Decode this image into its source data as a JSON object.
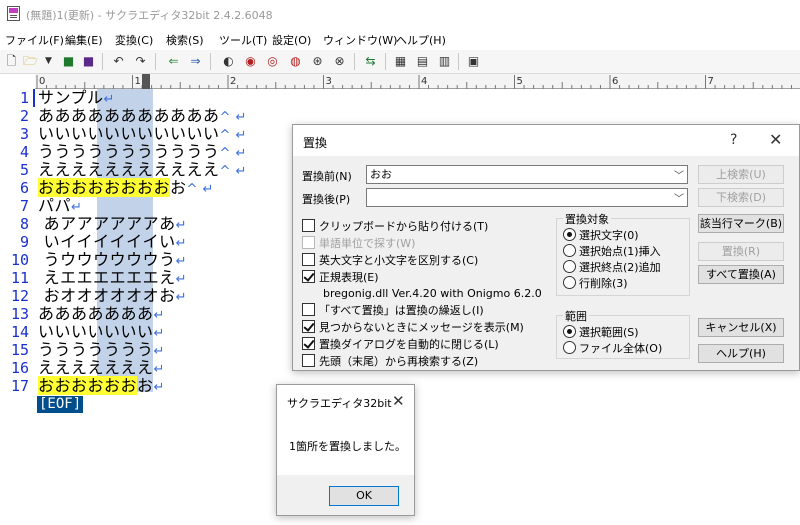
{
  "window": {
    "title": "(無題)1(更新) - サクラエディタ32bit 2.4.2.6048"
  },
  "menu": [
    {
      "label": "ファイル(F)"
    },
    {
      "label": "編集(E)"
    },
    {
      "label": "変換(C)"
    },
    {
      "label": "検索(S)"
    },
    {
      "label": "ツール(T)"
    },
    {
      "label": "設定(O)"
    },
    {
      "label": "ウィンドウ(W)"
    },
    {
      "label": "ヘルプ(H)"
    }
  ],
  "toolbar": {
    "icons": [
      "new-file-icon",
      "open-folder-icon",
      "dropdown-arrow-icon",
      "save-icon",
      "save-all-icon",
      "undo-icon",
      "redo-icon",
      "jump-back-icon",
      "jump-forward-icon",
      "search-prev-icon",
      "search-next-icon",
      "search-word-icon",
      "search-grep-icon",
      "search-mark-icon",
      "compare-icon",
      "tag-jump-icon",
      "outline-icon",
      "file-list-icon",
      "settings-icon",
      "window-list-icon"
    ]
  },
  "ruler": {
    "labels": [
      "0",
      "1",
      "2",
      "3",
      "4",
      "5",
      "6",
      "7"
    ]
  },
  "editor": {
    "colors": {
      "line_number": "#1a2fcf",
      "search_highlight": "#ffff33",
      "box_selection": "#c2d2e8",
      "eof_bg": "#004e8c"
    },
    "lines": [
      {
        "n": "1",
        "text": "サンプル",
        "hl": "",
        "eol": "↵"
      },
      {
        "n": "2",
        "text": "あああああああああああ",
        "hl": "",
        "eol": "^ ↵"
      },
      {
        "n": "3",
        "text": "いいいいいいいいいいい",
        "hl": "",
        "eol": "^ ↵"
      },
      {
        "n": "4",
        "text": "ううううううううううう",
        "hl": "",
        "eol": "^ ↵"
      },
      {
        "n": "5",
        "text": "えええええええええええ",
        "hl": "",
        "eol": "^ ↵"
      },
      {
        "n": "6",
        "text": "お",
        "hl": "おおおおおおおお",
        "eol": "^ ↵"
      },
      {
        "n": "7",
        "text": "パパ",
        "hl": "",
        "eol": "↵"
      },
      {
        "n": "8",
        "text": " あアアアアアアあ",
        "hl": "",
        "eol": "↵"
      },
      {
        "n": "9",
        "text": " いイイイイイイい",
        "hl": "",
        "eol": "↵"
      },
      {
        "n": "10",
        "text": " うウウウウウウう",
        "hl": "",
        "eol": "↵"
      },
      {
        "n": "11",
        "text": " えエエエエエエえ",
        "hl": "",
        "eol": "↵"
      },
      {
        "n": "12",
        "text": " おオオオオオオお",
        "hl": "",
        "eol": "↵"
      },
      {
        "n": "13",
        "text": "あああああああ",
        "hl": "",
        "eol": "↵"
      },
      {
        "n": "14",
        "text": "いいいいいいい",
        "hl": "",
        "eol": "↵"
      },
      {
        "n": "15",
        "text": "ううううううう",
        "hl": "",
        "eol": "↵"
      },
      {
        "n": "16",
        "text": "えええええええ",
        "hl": "",
        "eol": "↵"
      },
      {
        "n": "17",
        "text": "お",
        "hl": "おおおおおお",
        "eol": "↵"
      }
    ],
    "eof": "[EOF]"
  },
  "replace_dialog": {
    "title": "置換",
    "help_symbol": "?",
    "close_symbol": "✕",
    "find_label": "置換前(N)",
    "find_value": "おお",
    "replace_label": "置換後(P)",
    "replace_value": "",
    "buttons": {
      "search_up": "上検索(U)",
      "search_down": "下検索(D)",
      "mark": "該当行マーク(B)",
      "replace": "置換(R)",
      "replace_all": "すべて置換(A)",
      "cancel": "キャンセル(X)",
      "help": "ヘルプ(H)"
    },
    "options": [
      {
        "label": "クリップボードから貼り付ける(T)",
        "checked": false,
        "disabled": false
      },
      {
        "label": "単語単位で探す(W)",
        "checked": false,
        "disabled": true
      },
      {
        "label": "英大文字と小文字を区別する(C)",
        "checked": false,
        "disabled": false
      },
      {
        "label": "正規表現(E)",
        "checked": true,
        "disabled": false
      },
      {
        "label": "「すべて置換」は置換の繰返し(I)",
        "checked": false,
        "disabled": false
      },
      {
        "label": "見つからないときにメッセージを表示(M)",
        "checked": true,
        "disabled": false
      },
      {
        "label": "置換ダイアログを自動的に閉じる(L)",
        "checked": true,
        "disabled": false
      },
      {
        "label": "先頭（末尾）から再検索する(Z)",
        "checked": false,
        "disabled": false
      }
    ],
    "regex_lib": "bregonig.dll Ver.4.20 with Onigmo 6.2.0",
    "target_group": {
      "title": "置換対象",
      "options": [
        {
          "label": "選択文字(0)",
          "selected": true
        },
        {
          "label": "選択始点(1)挿入",
          "selected": false
        },
        {
          "label": "選択終点(2)追加",
          "selected": false
        },
        {
          "label": "行削除(3)",
          "selected": false
        }
      ]
    },
    "scope_group": {
      "title": "範囲",
      "options": [
        {
          "label": "選択範囲(S)",
          "selected": true
        },
        {
          "label": "ファイル全体(O)",
          "selected": false
        }
      ]
    }
  },
  "message_box": {
    "title": "サクラエディタ32bit",
    "close_symbol": "✕",
    "message": "1箇所を置換しました。",
    "ok_label": "OK"
  }
}
